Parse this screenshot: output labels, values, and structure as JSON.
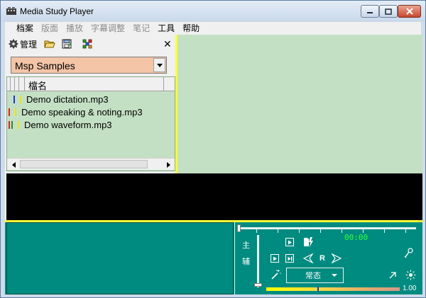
{
  "window": {
    "title": "Media Study Player"
  },
  "menu": {
    "items": [
      {
        "label": "档案",
        "enabled": true
      },
      {
        "label": "版面",
        "enabled": false
      },
      {
        "label": "播放",
        "enabled": false
      },
      {
        "label": "字幕调整",
        "enabled": false
      },
      {
        "label": "笔记",
        "enabled": false
      },
      {
        "label": "工具",
        "enabled": true
      },
      {
        "label": "帮助",
        "enabled": true
      }
    ]
  },
  "left_toolbar": {
    "manage_label": "管理",
    "close_glyph": "✕"
  },
  "collection_combo": {
    "value": "Msp Samples"
  },
  "file_list": {
    "header_name": "檔名",
    "rows": [
      {
        "name": "Demo dictation.mp3"
      },
      {
        "name": "Demo speaking & noting.mp3"
      },
      {
        "name": "Demo waveform.mp3"
      }
    ]
  },
  "controls": {
    "time": "00:00",
    "main_label": "主",
    "sub_label": "辅",
    "r_label": "R",
    "mode": "常态",
    "volume": 1.0,
    "volume_text": "1.00"
  },
  "colors": {
    "list_bg": "#c4e0c4",
    "combo_bg": "#f3c4a6",
    "control_bg": "#008b80",
    "splitter": "#ffff33",
    "time_text": "#33ff33"
  }
}
